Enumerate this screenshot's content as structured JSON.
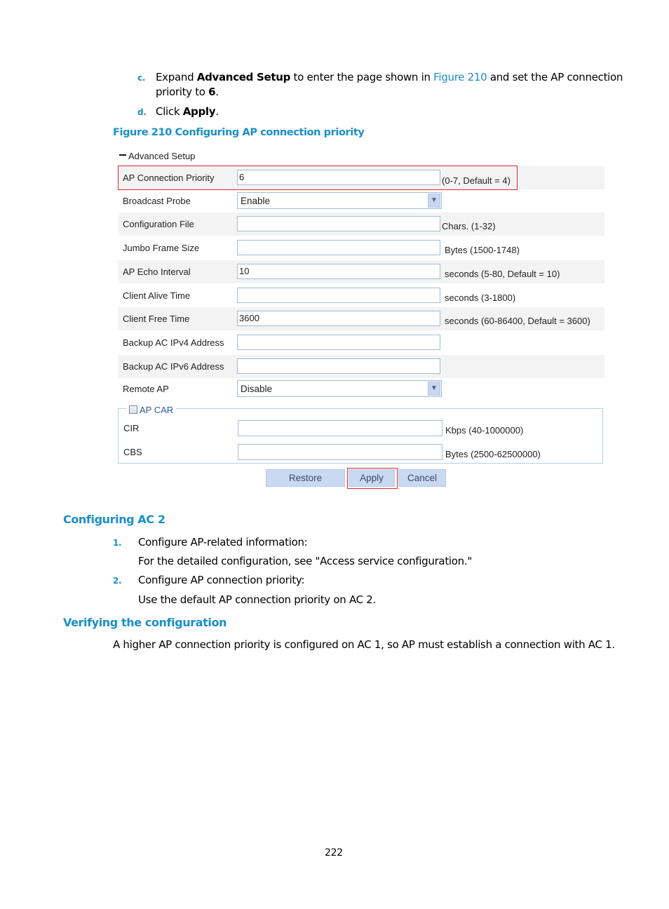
{
  "doc": {
    "step_c": {
      "marker": "c.",
      "text_1": "Expand ",
      "bold_1": "Advanced Setup",
      "text_2": " to enter the page shown in ",
      "link": "Figure 210",
      "text_3": " and set the AP connection",
      "line2_text": "priority to ",
      "line2_bold": "6",
      "line2_end": "."
    },
    "step_d": {
      "marker": "d.",
      "text": "Click ",
      "bold": "Apply",
      "end": "."
    },
    "figure_title": "Figure 210 Configuring AP connection priority",
    "section1": {
      "heading": "Configuring AC 2",
      "items": [
        {
          "marker": "1.",
          "text": "Configure AP-related information:",
          "detail": "For the detailed configuration, see \"Access service configuration.\""
        },
        {
          "marker": "2.",
          "text": "Configure AP connection priority:",
          "detail": "Use the default AP connection priority on AC 2."
        }
      ]
    },
    "section2": {
      "heading": "Verifying the configuration",
      "text": "A higher AP connection priority is configured on AC 1, so AP must establish a connection with AC 1."
    },
    "page_number": "222"
  },
  "ui": {
    "collapse_icon": "minus-icon",
    "section_title": "Advanced Setup",
    "rows": [
      {
        "label": "AP Connection Priority",
        "type": "text",
        "value": "6",
        "hint": "(0-7, Default = 4)"
      },
      {
        "label": "Broadcast Probe",
        "type": "select",
        "value": "Enable",
        "hint": ""
      },
      {
        "label": "Configuration File",
        "type": "text",
        "value": "",
        "hint": "Chars. (1-32)"
      },
      {
        "label": "Jumbo Frame Size",
        "type": "text",
        "value": "",
        "hint": "Bytes (1500-1748)"
      },
      {
        "label": "AP Echo Interval",
        "type": "text",
        "value": "10",
        "hint": "seconds (5-80, Default = 10)"
      },
      {
        "label": "Client Alive Time",
        "type": "text",
        "value": "",
        "hint": "seconds (3-1800)"
      },
      {
        "label": "Client Free Time",
        "type": "text",
        "value": "3600",
        "hint": "seconds (60-86400, Default = 3600)"
      },
      {
        "label": "Backup AC IPv4 Address",
        "type": "text",
        "value": "",
        "hint": ""
      },
      {
        "label": "Backup AC IPv6 Address",
        "type": "text",
        "value": "",
        "hint": ""
      },
      {
        "label": "Remote AP",
        "type": "select",
        "value": "Disable",
        "hint": ""
      }
    ],
    "ap_car": {
      "label": "AP CAR",
      "checked": false,
      "rows": [
        {
          "label": "CIR",
          "value": "",
          "hint": "Kbps (40-1000000)"
        },
        {
          "label": "CBS",
          "value": "",
          "hint": "Bytes (2500-62500000)"
        }
      ]
    },
    "buttons": {
      "restore": "Restore",
      "apply": "Apply",
      "cancel": "Cancel"
    },
    "colors": {
      "highlight": "#e0262e",
      "heading_blue": "#1a8fc9",
      "button_bg": "#c9d9f1"
    }
  }
}
